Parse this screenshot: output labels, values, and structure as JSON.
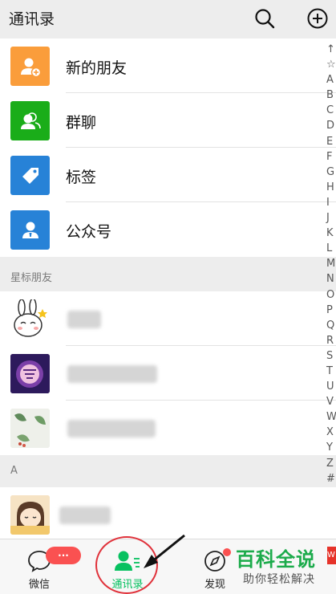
{
  "header": {
    "title": "通讯录",
    "search_icon": "search-icon",
    "add_icon": "plus-circle-icon"
  },
  "features": [
    {
      "label": "新的朋友",
      "icon": "add-friend-icon",
      "color": "#fa9d3b"
    },
    {
      "label": "群聊",
      "icon": "group-icon",
      "color": "#1aad19"
    },
    {
      "label": "标签",
      "icon": "tag-icon",
      "color": "#2782d7"
    },
    {
      "label": "公众号",
      "icon": "official-account-icon",
      "color": "#2782d7"
    }
  ],
  "sections": {
    "starred": "星标朋友",
    "a": "A"
  },
  "index_bar": [
    "↑",
    "☆",
    "A",
    "B",
    "C",
    "D",
    "E",
    "F",
    "G",
    "H",
    "I",
    "J",
    "K",
    "L",
    "M",
    "N",
    "O",
    "P",
    "Q",
    "R",
    "S",
    "T",
    "U",
    "V",
    "W",
    "X",
    "Y",
    "Z",
    "#"
  ],
  "tabbar": {
    "chats": {
      "label": "微信",
      "badge": "···"
    },
    "contacts": {
      "label": "通讯录"
    },
    "discover": {
      "label": "发现"
    }
  },
  "watermark": {
    "title": "百科全说",
    "subtitle": "助你轻松解决",
    "tag": "W"
  },
  "colors": {
    "accent": "#07c160",
    "badge": "#fa5151",
    "annotation": "#e0313a"
  }
}
